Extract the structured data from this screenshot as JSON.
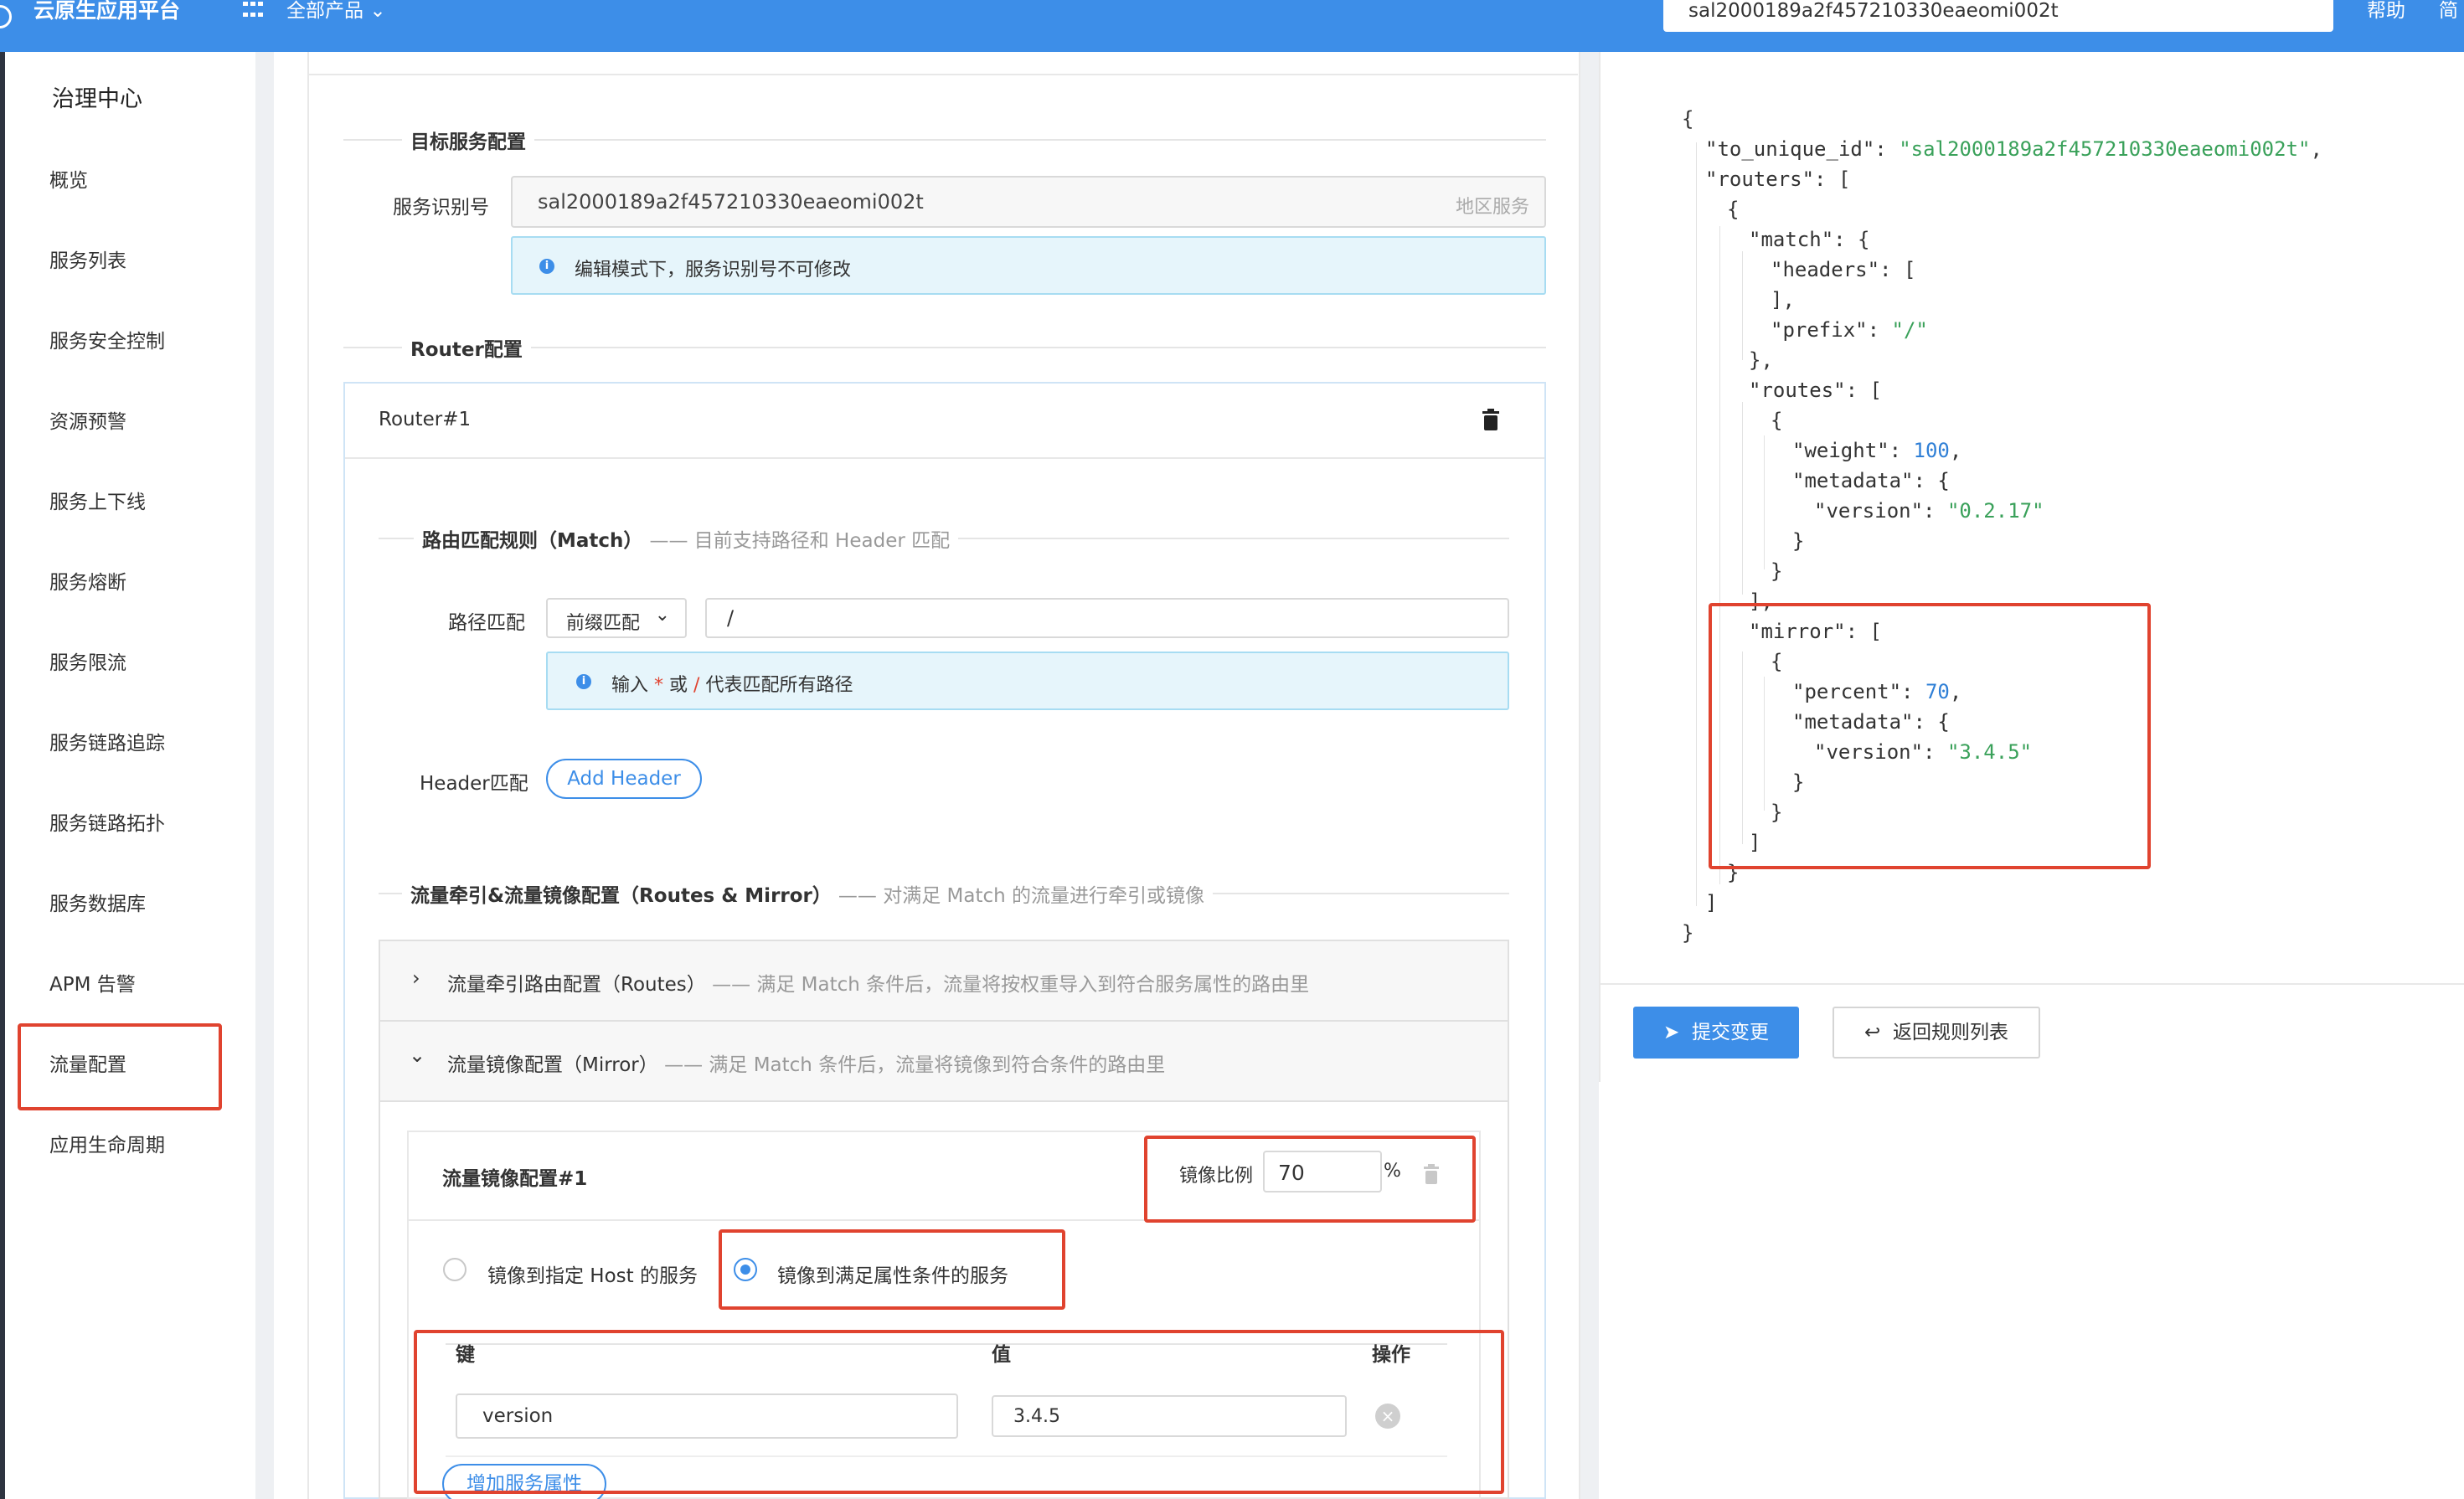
{
  "topbar": {
    "brand": "云原生应用平台",
    "all_products": "全部产品",
    "search_value": "sal2000189a2f457210330eaeomi002t",
    "help": "帮助",
    "more": "简"
  },
  "sidebar": {
    "title": "治理中心",
    "items": [
      "概览",
      "服务列表",
      "服务安全控制",
      "资源预警",
      "服务上下线",
      "服务熔断",
      "服务限流",
      "服务链路追踪",
      "服务链路拓扑",
      "服务数据库",
      "APM 告警",
      "流量配置",
      "应用生命周期"
    ],
    "active": "流量配置"
  },
  "target_section": {
    "title": "目标服务配置",
    "service_id_label": "服务识别号",
    "service_id_value": "sal2000189a2f457210330eaeomi002t",
    "service_id_suffix": "地区服务",
    "info": "编辑模式下，服务识别号不可修改"
  },
  "router_section": {
    "title": "Router配置",
    "router_name": "Router#1",
    "match_title": "路由匹配规则（Match）",
    "match_sub": "—— 目前支持路径和 Header 匹配",
    "path_label": "路径匹配",
    "path_mode": "前缀匹配",
    "path_value": "/",
    "path_info_prefix": "输入",
    "path_info_star": "*",
    "path_info_or": "或",
    "path_info_slash": "/",
    "path_info_suffix": "代表匹配所有路径",
    "header_label": "Header匹配",
    "add_header": "Add Header",
    "routes_title": "流量牵引&流量镜像配置（Routes & Mirror）",
    "routes_sub": "—— 对满足 Match 的流量进行牵引或镜像",
    "routes_row_title": "流量牵引路由配置（Routes）",
    "routes_row_sub": "—— 满足 Match 条件后，流量将按权重导入到符合服务属性的路由里",
    "mirror_row_title": "流量镜像配置（Mirror）",
    "mirror_row_sub": "—— 满足 Match 条件后，流量将镜像到符合条件的路由里",
    "mirror_card_title": "流量镜像配置#1",
    "mirror_ratio_label": "镜像比例",
    "mirror_ratio_value": "70",
    "mirror_ratio_unit": "%",
    "radio_host": "镜像到指定 Host 的服务",
    "radio_attr": "镜像到满足属性条件的服务",
    "table_headers": [
      "键",
      "值",
      "操作"
    ],
    "table_key": "version",
    "table_value": "3.4.5",
    "add_attr": "增加服务属性"
  },
  "json_preview": {
    "to_unique_id_key": "\"to_unique_id\"",
    "to_unique_id_val": "\"sal2000189a2f457210330eaeomi002t\"",
    "routers_key": "\"routers\"",
    "match_key": "\"match\"",
    "headers_key": "\"headers\"",
    "prefix_key": "\"prefix\"",
    "prefix_val": "\"/\"",
    "routes_key": "\"routes\"",
    "weight_key": "\"weight\"",
    "weight_val": "100",
    "metadata_key": "\"metadata\"",
    "version_key": "\"version\"",
    "version_val_routes": "\"0.2.17\"",
    "mirror_key": "\"mirror\"",
    "percent_key": "\"percent\"",
    "percent_val": "70",
    "version_val_mirror": "\"3.4.5\""
  },
  "actions": {
    "submit": "提交变更",
    "back": "返回规则列表"
  },
  "colors": {
    "primary": "#3d8ee8",
    "highlight_red": "#e0432f",
    "json_string": "#3aa15a",
    "json_number": "#2f7fd6"
  }
}
